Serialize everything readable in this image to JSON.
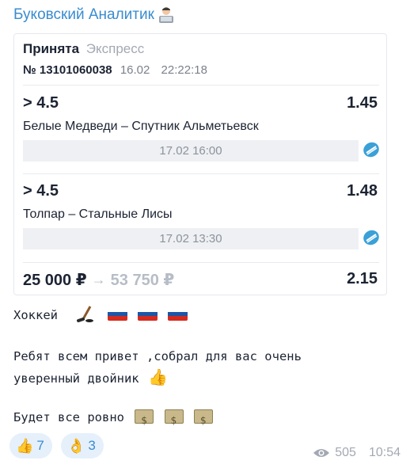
{
  "channel": {
    "name": "Буковский Аналитик"
  },
  "bet_card": {
    "status": "Принята",
    "type": "Экспресс",
    "number": "№ 13101060038",
    "date": "16.02",
    "time": "22:22:18",
    "events": [
      {
        "market": "> 4.5",
        "odds": "1.45",
        "teams": "Белые Медведи – Спутник Альметьевск",
        "datetime": "17.02 16:00",
        "sport_icon": "hockey-puck-icon"
      },
      {
        "market": "> 4.5",
        "odds": "1.48",
        "teams": "Толпар – Стальные Лисы",
        "datetime": "17.02 13:30",
        "sport_icon": "hockey-puck-icon"
      }
    ],
    "stake": "25 000 ₽",
    "arrow": "→",
    "potential_win": "53 750 ₽",
    "total_odds": "2.15"
  },
  "message": {
    "line1": "Хоккей",
    "line2": "Ребят всем привет ,собрал для вас очень",
    "line3": "уверенный двойник",
    "line4": "Будет все ровно"
  },
  "reactions": [
    {
      "emoji": "👍",
      "count": "7"
    },
    {
      "emoji": "👌",
      "count": "3"
    }
  ],
  "footer": {
    "views": "505",
    "time": "10:54"
  },
  "colors": {
    "accent": "#3a8ccf",
    "text": "#1c2333",
    "muted": "#a3a9b3"
  }
}
